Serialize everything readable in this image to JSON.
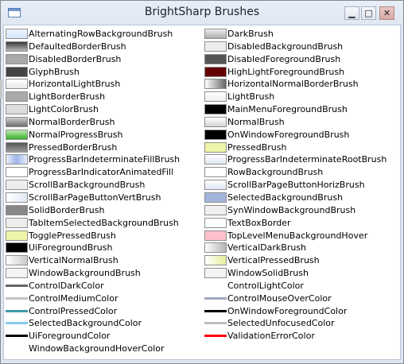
{
  "window": {
    "title": "BrightSharp Brushes"
  },
  "controls": {
    "minimize": "▁",
    "maximize": "□",
    "close": "✕"
  },
  "left_items": [
    {
      "label": "AlternatingRowBackgroundBrush",
      "swatch": "linear-gradient(#eaf3ff,#d6e6fb)"
    },
    {
      "label": "DefaultedBorderBrush",
      "swatch": "linear-gradient(#3a3a3a,#b9b9b9)"
    },
    {
      "label": "DisabledBorderBrush",
      "swatch": "#a9a9a9"
    },
    {
      "label": "GlyphBrush",
      "swatch": "#444444"
    },
    {
      "label": "HorizontalLightBrush",
      "swatch": "linear-gradient(#ffffff,#e9e9e9)"
    },
    {
      "label": "LightBorderBrush",
      "swatch": "#aaaaaa"
    },
    {
      "label": "LightColorBrush",
      "swatch": "#dddddd"
    },
    {
      "label": "NormalBorderBrush",
      "swatch": "linear-gradient(#cfcfcf,#6f6f6f)"
    },
    {
      "label": "NormalProgressBrush",
      "swatch": "linear-gradient(#b9e9b0,#3cae2c)"
    },
    {
      "label": "PressedBorderBrush",
      "swatch": "linear-gradient(#555555,#9a9a9a)"
    },
    {
      "label": "ProgressBarIndeterminateFillBrush",
      "swatch": "linear-gradient(90deg,#e8eefc,#9fb6ea,#e8eefc)"
    },
    {
      "label": "ProgressBarIndicatorAnimatedFill",
      "swatch": "#ffffff"
    },
    {
      "label": "ScrollBarBackgroundBrush",
      "swatch": "#eeeeee"
    },
    {
      "label": "ScrollBarPageButtonVertBrush",
      "swatch": "linear-gradient(90deg,#ffffff,#dfe8f6)"
    },
    {
      "label": "SolidBorderBrush",
      "swatch": "#888888"
    },
    {
      "label": "TabItemSelectedBackgroundBrush",
      "swatch": "#ededed"
    },
    {
      "label": "TogglePressedBrush",
      "swatch": "#eef4a8"
    },
    {
      "label": "UiForegroundBrush",
      "swatch": "#000000"
    },
    {
      "label": "VerticalNormalBrush",
      "swatch": "linear-gradient(90deg,#ffffff,#c9c9c9)"
    },
    {
      "label": "WindowBackgroundBrush",
      "swatch": "#f3f3f3"
    },
    {
      "label": "ControlDarkColor",
      "line": "#666666"
    },
    {
      "label": "ControlMediumColor",
      "line": "#c4c4c4"
    },
    {
      "label": "ControlPressedColor",
      "line": "#3e9aa6"
    },
    {
      "label": "SelectedBackgroundColor",
      "line": "#86c9ec"
    },
    {
      "label": "UiForegroundColor",
      "line": "#000000"
    },
    {
      "label": "WindowBackgroundHoverColor",
      "line": ""
    }
  ],
  "right_items": [
    {
      "label": "DarkBrush",
      "swatch": "linear-gradient(#eeeeee,#aaaaaa)"
    },
    {
      "label": "DisabledBackgroundBrush",
      "swatch": "#ececec"
    },
    {
      "label": "DisabledForegroundBrush",
      "swatch": "#555555"
    },
    {
      "label": "HighLightForegroundBrush",
      "swatch": "#650000"
    },
    {
      "label": "HorizontalNormalBorderBrush",
      "swatch": "linear-gradient(90deg,#ffffff,#666666)"
    },
    {
      "label": "LightBrush",
      "swatch": "linear-gradient(#ffffff,#eeeeee)"
    },
    {
      "label": "MainMenuForegroundBrush",
      "swatch": "#000000"
    },
    {
      "label": "NormalBrush",
      "swatch": "linear-gradient(#ffffff,#d4d4d4)"
    },
    {
      "label": "OnWindowForegroundBrush",
      "swatch": "#000000"
    },
    {
      "label": "PressedBrush",
      "swatch": "#eef4a8"
    },
    {
      "label": "ProgressBarIndeterminateRootBrush",
      "swatch": "linear-gradient(#ffffff,#dfe6f2)"
    },
    {
      "label": "RowBackgroundBrush",
      "swatch": "#ffffff"
    },
    {
      "label": "ScrollBarPageButtonHorizBrush",
      "swatch": "linear-gradient(#ffffff,#dfe8f6)"
    },
    {
      "label": "SelectedBackgroundBrush",
      "swatch": "#a3b5dd"
    },
    {
      "label": "SynWindowBackgroundBrush",
      "swatch": "#f0f0f0"
    },
    {
      "label": "TextBoxBorder",
      "swatch": "#ffffff"
    },
    {
      "label": "TopLevelMenuBackgroundHover",
      "swatch": "#ffc0cb"
    },
    {
      "label": "VerticalDarkBrush",
      "swatch": "linear-gradient(90deg,#ffffff,#b4b4b4)"
    },
    {
      "label": "VerticalPressedBrush",
      "swatch": "linear-gradient(90deg,#ffffff,#e4ee98)"
    },
    {
      "label": "WindowSolidBrush",
      "swatch": "#f4f4f4"
    },
    {
      "label": "ControlLightColor",
      "line": "#ffffff"
    },
    {
      "label": "ControlMouseOverColor",
      "line": "#a2a9bd"
    },
    {
      "label": "OnWindowForegroundColor",
      "line": "#000000"
    },
    {
      "label": "SelectedUnfocusedColor",
      "line": "#bdbdbd"
    },
    {
      "label": "ValidationErrorColor",
      "line": "#ff0000"
    }
  ]
}
